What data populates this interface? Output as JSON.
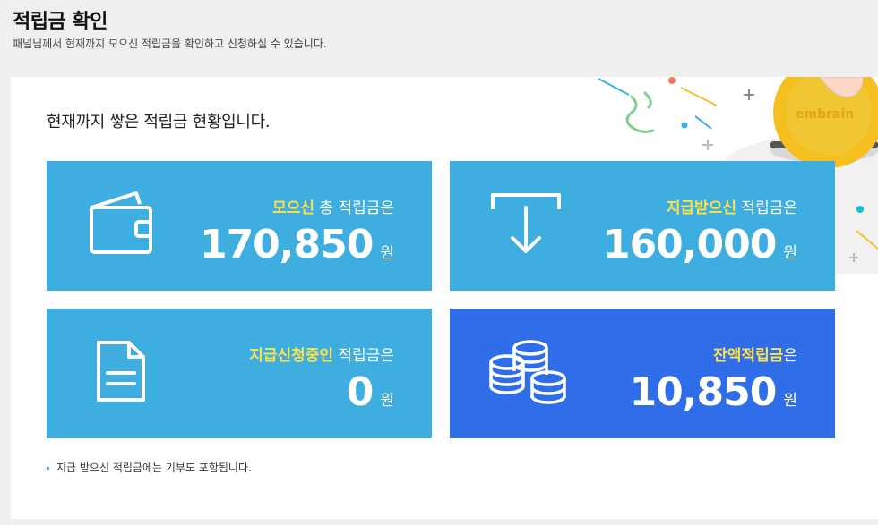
{
  "header": {
    "title": "적립금 확인",
    "subtitle": "패널님께서 현재까지 모으신 적립금을 확인하고 신청하실 수 있습니다."
  },
  "panel": {
    "intro": "현재까지 쌓은 적립금 현황입니다.",
    "logo_text": "embrain"
  },
  "cards": [
    {
      "icon": "wallet-icon",
      "highlight": "모으신",
      "label_rest": " 총 적립금은",
      "amount": "170,850",
      "unit": "원",
      "color": "#3eaee0"
    },
    {
      "icon": "download-arrow-icon",
      "highlight": "지급받으신",
      "label_rest": " 적립금은",
      "amount": "160,000",
      "unit": "원",
      "color": "#3eaee0"
    },
    {
      "icon": "document-icon",
      "highlight": "지급신청중인",
      "label_rest": " 적립금은",
      "amount": "0",
      "unit": "원",
      "color": "#3eaee0"
    },
    {
      "icon": "coins-icon",
      "highlight": "잔액적립금",
      "label_rest": "은",
      "amount": "10,850",
      "unit": "원",
      "color": "#2f6ee8"
    }
  ],
  "note": "지급 받으신 적립금에는 기부도 포함됩니다.",
  "colors": {
    "highlight": "#ffe14a",
    "card_blue": "#3eaee0",
    "card_dark_blue": "#2f6ee8"
  }
}
